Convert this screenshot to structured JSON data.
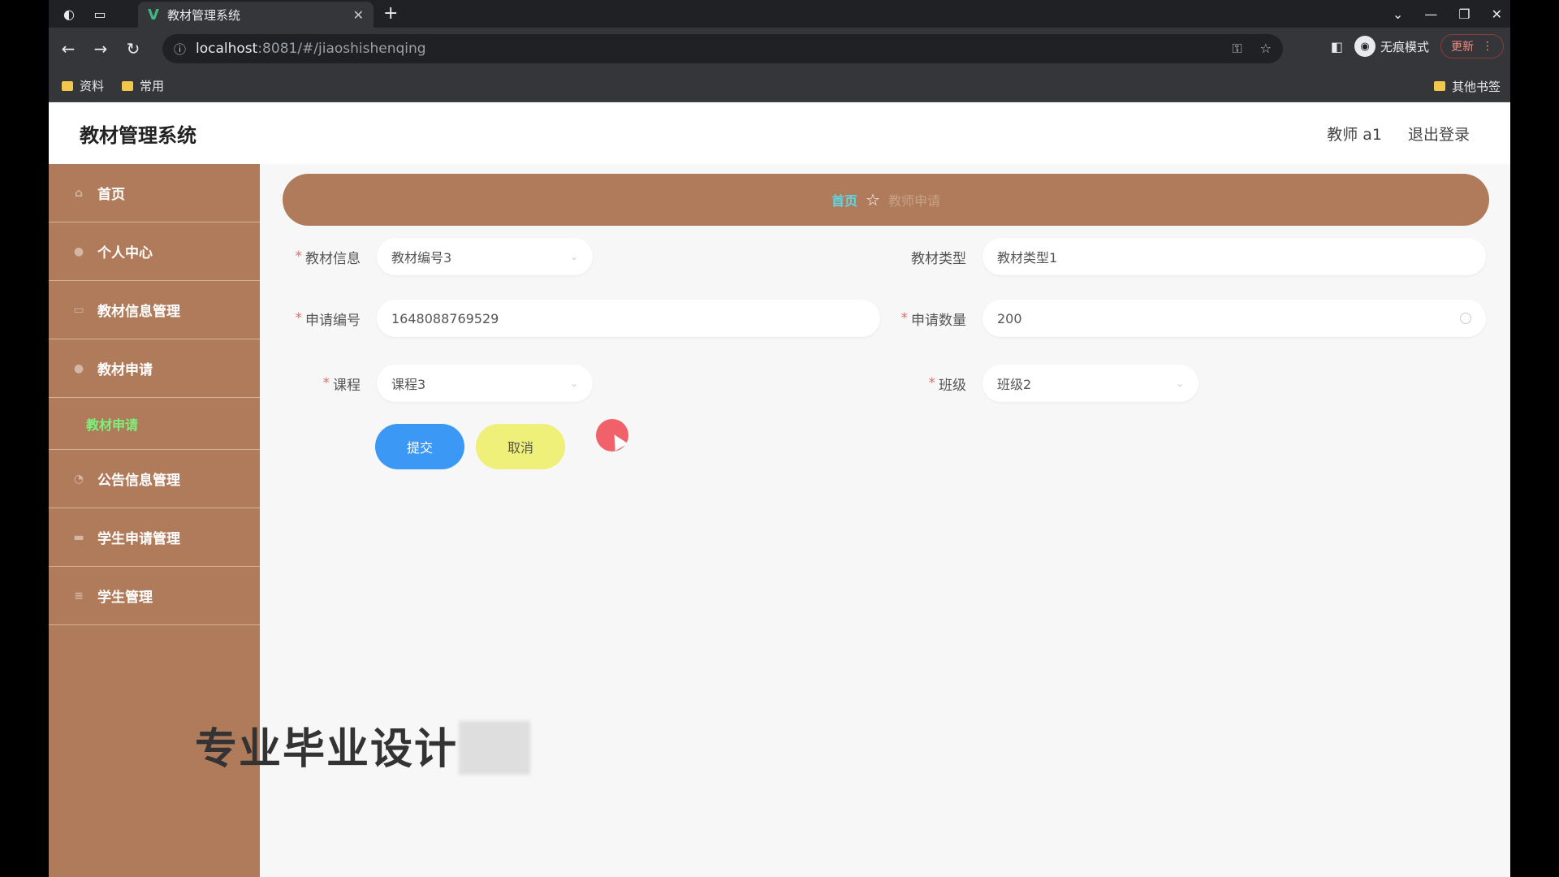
{
  "browser": {
    "tab_title": "教材管理系统",
    "url_host": "localhost",
    "url_rest": ":8081/#/jiaoshishenqing",
    "incognito_label": "无痕模式",
    "update_label": "更新",
    "bookmarks": [
      "资料",
      "常用"
    ],
    "other_bookmarks": "其他书签"
  },
  "app": {
    "title": "教材管理系统",
    "user": "教师 a1",
    "logout": "退出登录"
  },
  "sidebar": {
    "items": [
      {
        "label": "首页",
        "icon": "home-icon"
      },
      {
        "label": "个人中心",
        "icon": "user-icon"
      },
      {
        "label": "教材信息管理",
        "icon": "book-icon"
      },
      {
        "label": "教材申请",
        "icon": "apply-icon"
      },
      {
        "label": "公告信息管理",
        "icon": "notice-icon"
      },
      {
        "label": "学生申请管理",
        "icon": "student-apply-icon"
      },
      {
        "label": "学生管理",
        "icon": "student-icon"
      }
    ],
    "sub_item": "教材申请"
  },
  "breadcrumb": {
    "home": "首页",
    "current": "教师申请"
  },
  "form": {
    "textbook_info_label": "教材信息",
    "textbook_info_value": "教材编号3",
    "textbook_type_label": "教材类型",
    "textbook_type_value": "教材类型1",
    "apply_no_label": "申请编号",
    "apply_no_value": "1648088769529",
    "apply_qty_label": "申请数量",
    "apply_qty_value": "200",
    "course_label": "课程",
    "course_value": "课程3",
    "class_label": "班级",
    "class_value": "班级2",
    "submit": "提交",
    "cancel": "取消"
  },
  "overlay": {
    "watermark": "专业毕业设计"
  },
  "colors": {
    "brand": "#b07b5a",
    "submit": "#3c98f5",
    "cancel": "#eef07a",
    "active_sub": "#7cf27c",
    "breadcrumb_home": "#5bd7e8"
  }
}
